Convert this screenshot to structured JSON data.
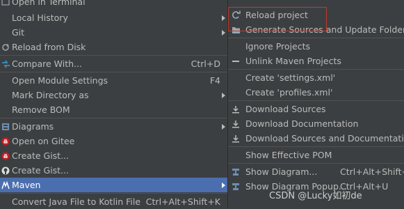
{
  "main_menu": {
    "open_in_terminal": "Open in Terminal",
    "local_history": "Local History",
    "git": "Git",
    "reload_from_disk": "Reload from Disk",
    "compare_with": "Compare With...",
    "compare_with_shortcut": "Ctrl+D",
    "open_module_settings": "Open Module Settings",
    "open_module_settings_shortcut": "F4",
    "mark_directory_as": "Mark Directory as",
    "remove_bom": "Remove BOM",
    "diagrams": "Diagrams",
    "open_on_gitee": "Open on Gitee",
    "create_gist_1": "Create Gist...",
    "create_gist_2": "Create Gist...",
    "maven": "Maven",
    "convert_kotlin": "Convert Java File to Kotlin File",
    "convert_kotlin_shortcut": "Ctrl+Alt+Shift+K"
  },
  "sub_menu": {
    "reload_project": "Reload project",
    "generate_sources": "Generate Sources and Update Folders",
    "ignore_projects": "Ignore Projects",
    "unlink_maven": "Unlink Maven Projects",
    "create_settings": "Create 'settings.xml'",
    "create_profiles": "Create 'profiles.xml'",
    "download_sources": "Download Sources",
    "download_documentation": "Download Documentation",
    "download_both": "Download Sources and Documentation",
    "show_effective_pom": "Show Effective POM",
    "show_diagram": "Show Diagram...",
    "show_diagram_shortcut": "Ctrl+Alt+Shift+U",
    "show_diagram_popup": "Show Diagram Popup...",
    "show_diagram_popup_shortcut": "Ctrl+Alt+U"
  },
  "watermark": "CSDN @Lucky如初de",
  "colors": {
    "background": "#3c3f41",
    "selection": "#4b6eaf",
    "text": "#bbbbbb",
    "highlight_box": "#c0392b"
  }
}
